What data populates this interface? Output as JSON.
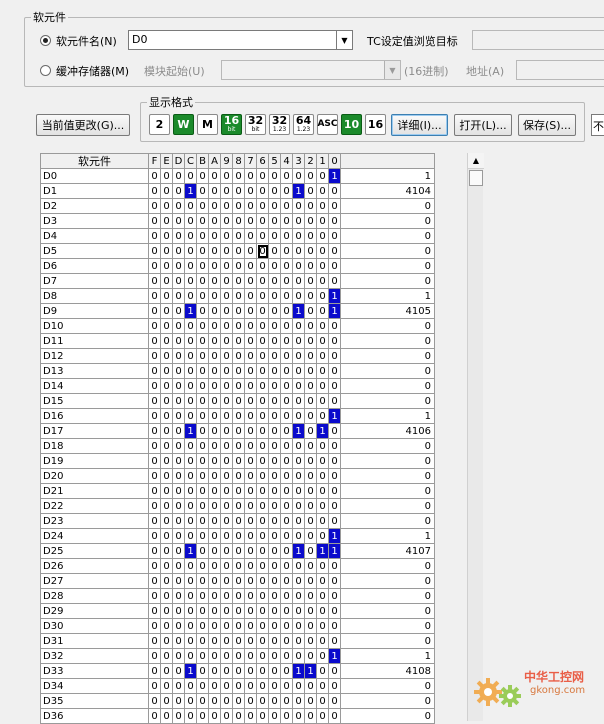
{
  "device_group": {
    "title": "软元件",
    "device_name_label": "软元件名(N)",
    "device_name_value": "D0",
    "tc_label": "TC设定值浏览目标",
    "buffer_label": "缓冲存储器(M)",
    "module_start_label": "模块起始(U)",
    "hex_label": "(16进制)",
    "address_label": "地址(A)"
  },
  "display_format": {
    "title": "显示格式",
    "buttons": [
      "2",
      "W",
      "M",
      "16",
      "32",
      "32",
      "64",
      "ASC",
      "10",
      "16"
    ],
    "subs": [
      "",
      "",
      "",
      "bit",
      "bit",
      "1.23",
      "1.23",
      "",
      "",
      ""
    ]
  },
  "toolbar": {
    "change_value_label": "当前值更改(G)...",
    "detail_label": "详细(I)...",
    "open_label": "打开(L)...",
    "save_label": "保存(S)...",
    "right_cut_label": "不"
  },
  "table": {
    "name_header": "软元件",
    "bit_headers": [
      "F",
      "E",
      "D",
      "C",
      "B",
      "A",
      "9",
      "8",
      "7",
      "6",
      "5",
      "4",
      "3",
      "2",
      "1",
      "0"
    ],
    "rows": [
      {
        "name": "D0",
        "value": "1"
      },
      {
        "name": "D1",
        "value": "4104"
      },
      {
        "name": "D2",
        "value": "0"
      },
      {
        "name": "D3",
        "value": "0"
      },
      {
        "name": "D4",
        "value": "0"
      },
      {
        "name": "D5",
        "value": "0"
      },
      {
        "name": "D6",
        "value": "0"
      },
      {
        "name": "D7",
        "value": "0"
      },
      {
        "name": "D8",
        "value": "1"
      },
      {
        "name": "D9",
        "value": "4105"
      },
      {
        "name": "D10",
        "value": "0"
      },
      {
        "name": "D11",
        "value": "0"
      },
      {
        "name": "D12",
        "value": "0"
      },
      {
        "name": "D13",
        "value": "0"
      },
      {
        "name": "D14",
        "value": "0"
      },
      {
        "name": "D15",
        "value": "0"
      },
      {
        "name": "D16",
        "value": "1"
      },
      {
        "name": "D17",
        "value": "4106"
      },
      {
        "name": "D18",
        "value": "0"
      },
      {
        "name": "D19",
        "value": "0"
      },
      {
        "name": "D20",
        "value": "0"
      },
      {
        "name": "D21",
        "value": "0"
      },
      {
        "name": "D22",
        "value": "0"
      },
      {
        "name": "D23",
        "value": "0"
      },
      {
        "name": "D24",
        "value": "1"
      },
      {
        "name": "D25",
        "value": "4107"
      },
      {
        "name": "D26",
        "value": "0"
      },
      {
        "name": "D27",
        "value": "0"
      },
      {
        "name": "D28",
        "value": "0"
      },
      {
        "name": "D29",
        "value": "0"
      },
      {
        "name": "D30",
        "value": "0"
      },
      {
        "name": "D31",
        "value": "0"
      },
      {
        "name": "D32",
        "value": "1"
      },
      {
        "name": "D33",
        "value": "4108"
      },
      {
        "name": "D34",
        "value": "0"
      },
      {
        "name": "D35",
        "value": "0"
      },
      {
        "name": "D36",
        "value": "0"
      }
    ],
    "selected_cell": {
      "row": "D5",
      "bit": "6"
    }
  },
  "watermark": {
    "text_cn": "中华工控网",
    "text_url": "gkong.com"
  },
  "colors": {
    "bit_on": "#0a0acc",
    "format_green": "#1b8a2b"
  }
}
